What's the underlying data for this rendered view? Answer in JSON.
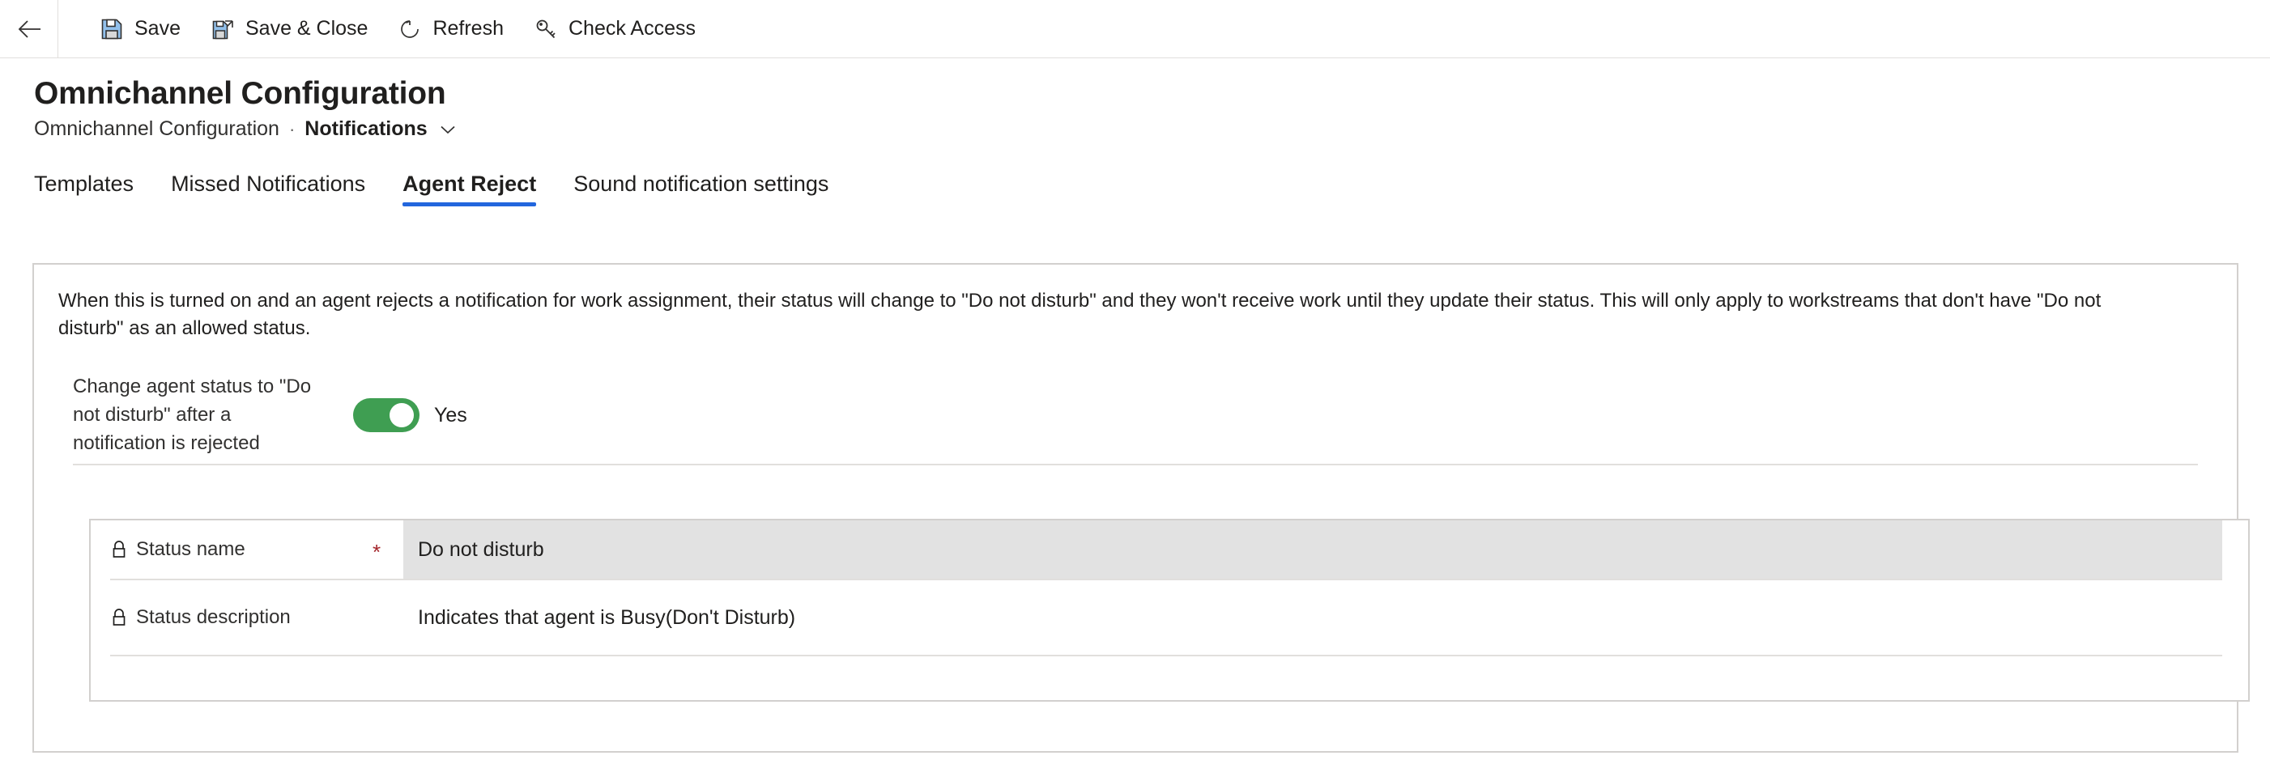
{
  "commandbar": {
    "back_icon": "arrow-left-icon",
    "buttons": [
      {
        "label": "Save",
        "icon": "save-floppy-icon"
      },
      {
        "label": "Save & Close",
        "icon": "save-and-close-icon"
      },
      {
        "label": "Refresh",
        "icon": "refresh-icon"
      },
      {
        "label": "Check Access",
        "icon": "key-icon"
      }
    ]
  },
  "header": {
    "title": "Omnichannel Configuration",
    "breadcrumb_parent": "Omnichannel Configuration",
    "breadcrumb_separator": "·",
    "breadcrumb_current": "Notifications"
  },
  "tabs": [
    {
      "label": "Templates",
      "active": false
    },
    {
      "label": "Missed Notifications",
      "active": false
    },
    {
      "label": "Agent Reject",
      "active": true
    },
    {
      "label": "Sound notification settings",
      "active": false
    }
  ],
  "panel": {
    "description": "When this is turned on and an agent rejects a notification for work assignment, their status will change to \"Do not disturb\" and they won't receive work until they update their status. This will only apply to workstreams that don't have \"Do not disturb\" as an allowed status.",
    "toggle": {
      "label": "Change agent status to \"Do not disturb\" after a notification is rejected",
      "state_text": "Yes",
      "on": true
    },
    "fields": [
      {
        "label": "Status name",
        "icon": "lock-icon",
        "required_marker": "*",
        "value": "Do not disturb",
        "filled": true
      },
      {
        "label": "Status description",
        "icon": "lock-icon",
        "required_marker": "",
        "value": "Indicates that agent is Busy(Don't Disturb)",
        "filled": false
      }
    ]
  },
  "colors": {
    "accent": "#2266dd",
    "toggle_on": "#3f9e52",
    "required": "#a4262c",
    "border": "#d2d0ce",
    "field_fill": "#e2e2e2"
  }
}
